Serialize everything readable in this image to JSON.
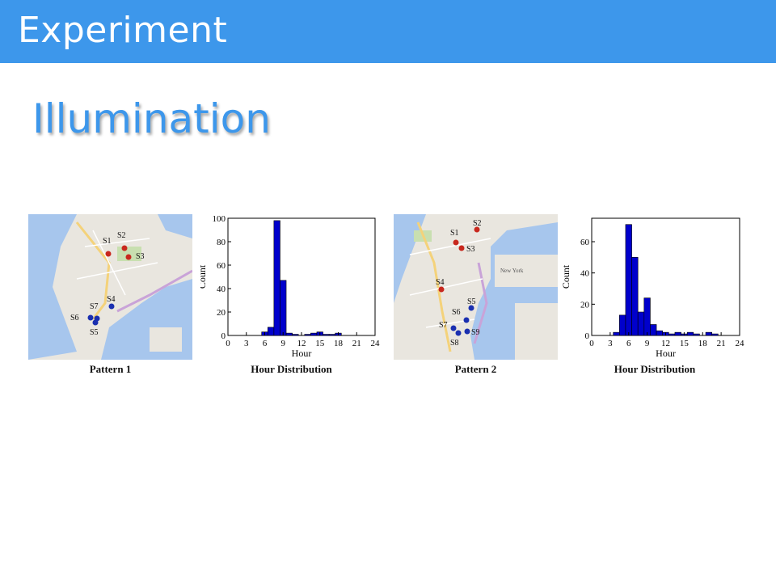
{
  "slide": {
    "title": "Experiment",
    "subtitle": "Illumination"
  },
  "colors": {
    "header": "#3d97eb",
    "bar": "#0000cc",
    "water": "#a7c6ed",
    "land": "#e9e6df",
    "park": "#c8dfb0",
    "red_marker": "#c8281e",
    "blue_marker": "#1a2fb0"
  },
  "panels": [
    {
      "caption": "Pattern 1",
      "kind": "map",
      "markers": [
        {
          "label": "S1",
          "color": "red"
        },
        {
          "label": "S2",
          "color": "red"
        },
        {
          "label": "S3",
          "color": "red"
        },
        {
          "label": "S4",
          "color": "blue"
        },
        {
          "label": "S5",
          "color": "blue"
        },
        {
          "label": "S6",
          "color": "blue"
        },
        {
          "label": "S7",
          "color": "blue"
        }
      ]
    },
    {
      "caption": "Hour Distribution",
      "kind": "chart"
    },
    {
      "caption": "Pattern 2",
      "kind": "map",
      "map_label": "New York",
      "markers": [
        {
          "label": "S1",
          "color": "red"
        },
        {
          "label": "S2",
          "color": "red"
        },
        {
          "label": "S3",
          "color": "red"
        },
        {
          "label": "S4",
          "color": "red"
        },
        {
          "label": "S5",
          "color": "blue"
        },
        {
          "label": "S6",
          "color": "blue"
        },
        {
          "label": "S7",
          "color": "blue"
        },
        {
          "label": "S8",
          "color": "blue"
        },
        {
          "label": "S9",
          "color": "blue"
        }
      ]
    },
    {
      "caption": "Hour Distribution",
      "kind": "chart"
    }
  ],
  "chart_data": [
    {
      "type": "bar",
      "xlabel": "Hour",
      "ylabel": "Count",
      "xlim": [
        0,
        24
      ],
      "ylim": [
        0,
        100
      ],
      "xticks": [
        0,
        3,
        6,
        9,
        12,
        15,
        18,
        21,
        24
      ],
      "yticks": [
        0,
        20,
        40,
        60,
        80,
        100
      ],
      "x": [
        5,
        6,
        7,
        8,
        9,
        10,
        11,
        12,
        13,
        14,
        15,
        16,
        17,
        18,
        19,
        20,
        21
      ],
      "values": [
        0,
        3,
        7,
        98,
        47,
        2,
        1,
        0,
        1,
        2,
        3,
        1,
        1,
        2,
        0,
        0,
        0
      ]
    },
    {
      "type": "bar",
      "xlabel": "Hour",
      "ylabel": "Count",
      "xlim": [
        0,
        24
      ],
      "ylim": [
        0,
        75
      ],
      "xticks": [
        0,
        3,
        6,
        9,
        12,
        15,
        18,
        21,
        24
      ],
      "yticks": [
        0,
        20,
        40,
        60
      ],
      "x": [
        4,
        5,
        6,
        7,
        8,
        9,
        10,
        11,
        12,
        13,
        14,
        15,
        16,
        17,
        18,
        19,
        20
      ],
      "values": [
        2,
        13,
        71,
        50,
        15,
        24,
        7,
        3,
        2,
        1,
        2,
        1,
        2,
        1,
        0,
        2,
        1
      ]
    }
  ]
}
